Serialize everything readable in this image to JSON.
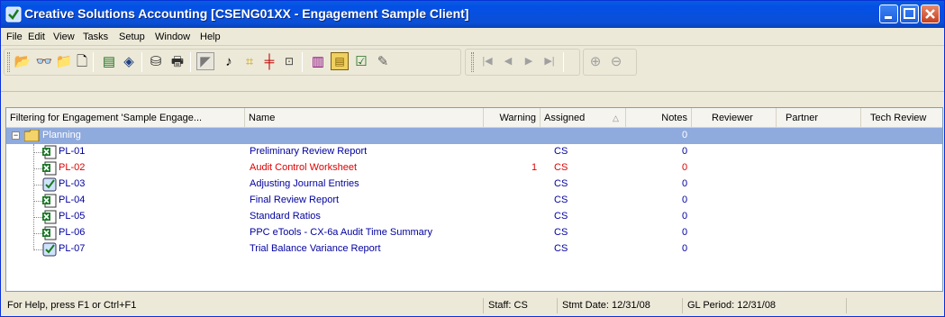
{
  "window": {
    "title": "Creative Solutions Accounting [CSENG01XX - Engagement Sample Client]"
  },
  "menu": [
    "File",
    "Edit",
    "View",
    "Tasks",
    "Setup",
    "Window",
    "Help"
  ],
  "toolbar": {
    "icons": [
      "open-folder-icon",
      "binoculars-icon",
      "new-folder-icon",
      "new-document-icon",
      "ledger-icon",
      "diamond-icon",
      "disk-icon",
      "print-icon",
      "prepare-icon",
      "note-icon",
      "tickmark-icon",
      "cross-icon",
      "reference-icon",
      "books-icon",
      "sign-icon",
      "review-icon",
      "signoff-icon",
      "first-record-icon",
      "previous-record-icon",
      "next-record-icon",
      "last-record-icon",
      "zoom-in-icon",
      "zoom-out-icon"
    ]
  },
  "columns": {
    "filter": "Filtering for Engagement 'Sample Engage...",
    "name": "Name",
    "warning": "Warning",
    "assigned": "Assigned",
    "notes": "Notes",
    "reviewer": "Reviewer",
    "partner": "Partner",
    "tech_review": "Tech Review"
  },
  "folder": {
    "label": "Planning",
    "notes": "0"
  },
  "rows": [
    {
      "id": "PL-01",
      "name": "Preliminary Review Report",
      "warning": "",
      "assigned": "CS",
      "notes": "0",
      "icon": "excel-icon",
      "status": "normal"
    },
    {
      "id": "PL-02",
      "name": "Audit Control Worksheet",
      "warning": "1",
      "assigned": "CS",
      "notes": "0",
      "icon": "excel-icon",
      "status": "warning"
    },
    {
      "id": "PL-03",
      "name": "Adjusting Journal Entries",
      "warning": "",
      "assigned": "CS",
      "notes": "0",
      "icon": "checkmark-doc-icon",
      "status": "normal"
    },
    {
      "id": "PL-04",
      "name": "Final Review Report",
      "warning": "",
      "assigned": "CS",
      "notes": "0",
      "icon": "excel-icon",
      "status": "normal"
    },
    {
      "id": "PL-05",
      "name": "Standard Ratios",
      "warning": "",
      "assigned": "CS",
      "notes": "0",
      "icon": "excel-icon",
      "status": "normal"
    },
    {
      "id": "PL-06",
      "name": "PPC eTools - CX-6a Audit Time Summary",
      "warning": "",
      "assigned": "CS",
      "notes": "0",
      "icon": "excel-icon",
      "status": "normal"
    },
    {
      "id": "PL-07",
      "name": "Trial Balance Variance Report",
      "warning": "",
      "assigned": "CS",
      "notes": "0",
      "icon": "checkmark-doc-icon",
      "status": "normal"
    }
  ],
  "status": {
    "help": "For Help, press F1 or Ctrl+F1",
    "staff": "Staff: CS",
    "stmt_date": "Stmt Date: 12/31/08",
    "gl_period": "GL Period: 12/31/08"
  },
  "colors": {
    "titlebar": "#0a4fd6",
    "selected_row": "#8faadc",
    "link_blue": "#0000a0",
    "warning_red": "#e00000"
  }
}
